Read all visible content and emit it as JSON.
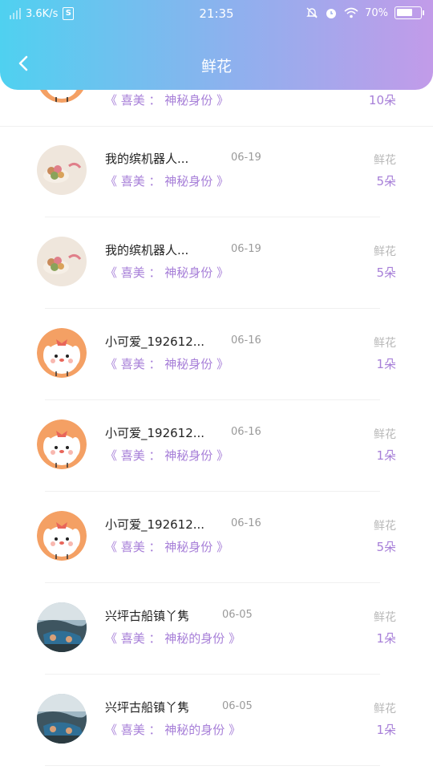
{
  "status": {
    "speed": "3.6K/s",
    "time": "21:35",
    "battery": "70%",
    "battery_level": 0.7
  },
  "header": {
    "title": "鲜花"
  },
  "partial_row": {
    "gift": "《 喜美 ： 神秘身份 》",
    "count": "10朵"
  },
  "rows": [
    {
      "name": "我的缤机器人...",
      "date": "06-19",
      "gift": "《 喜美 ： 神秘身份 》",
      "label": "鲜花",
      "count": "5朵",
      "avatar": "food"
    },
    {
      "name": "我的缤机器人...",
      "date": "06-19",
      "gift": "《 喜美 ： 神秘身份 》",
      "label": "鲜花",
      "count": "5朵",
      "avatar": "food"
    },
    {
      "name": "小可爱_192612...",
      "date": "06-16",
      "gift": "《 喜美 ： 神秘身份 》",
      "label": "鲜花",
      "count": "1朵",
      "avatar": "bunny"
    },
    {
      "name": "小可爱_192612...",
      "date": "06-16",
      "gift": "《 喜美 ： 神秘身份 》",
      "label": "鲜花",
      "count": "1朵",
      "avatar": "bunny"
    },
    {
      "name": "小可爱_192612...",
      "date": "06-16",
      "gift": "《 喜美 ： 神秘身份 》",
      "label": "鲜花",
      "count": "5朵",
      "avatar": "bunny"
    },
    {
      "name": "兴坪古船镇丫隽",
      "date": "06-05",
      "gift": "《 喜美 ： 神秘的身份 》",
      "label": "鲜花",
      "count": "1朵",
      "avatar": "photo"
    },
    {
      "name": "兴坪古船镇丫隽",
      "date": "06-05",
      "gift": "《 喜美 ： 神秘的身份 》",
      "label": "鲜花",
      "count": "1朵",
      "avatar": "photo"
    }
  ],
  "colors": {
    "accent": "#a77fd8",
    "gradient_start": "#4fd1f0",
    "gradient_end": "#c29be9"
  }
}
